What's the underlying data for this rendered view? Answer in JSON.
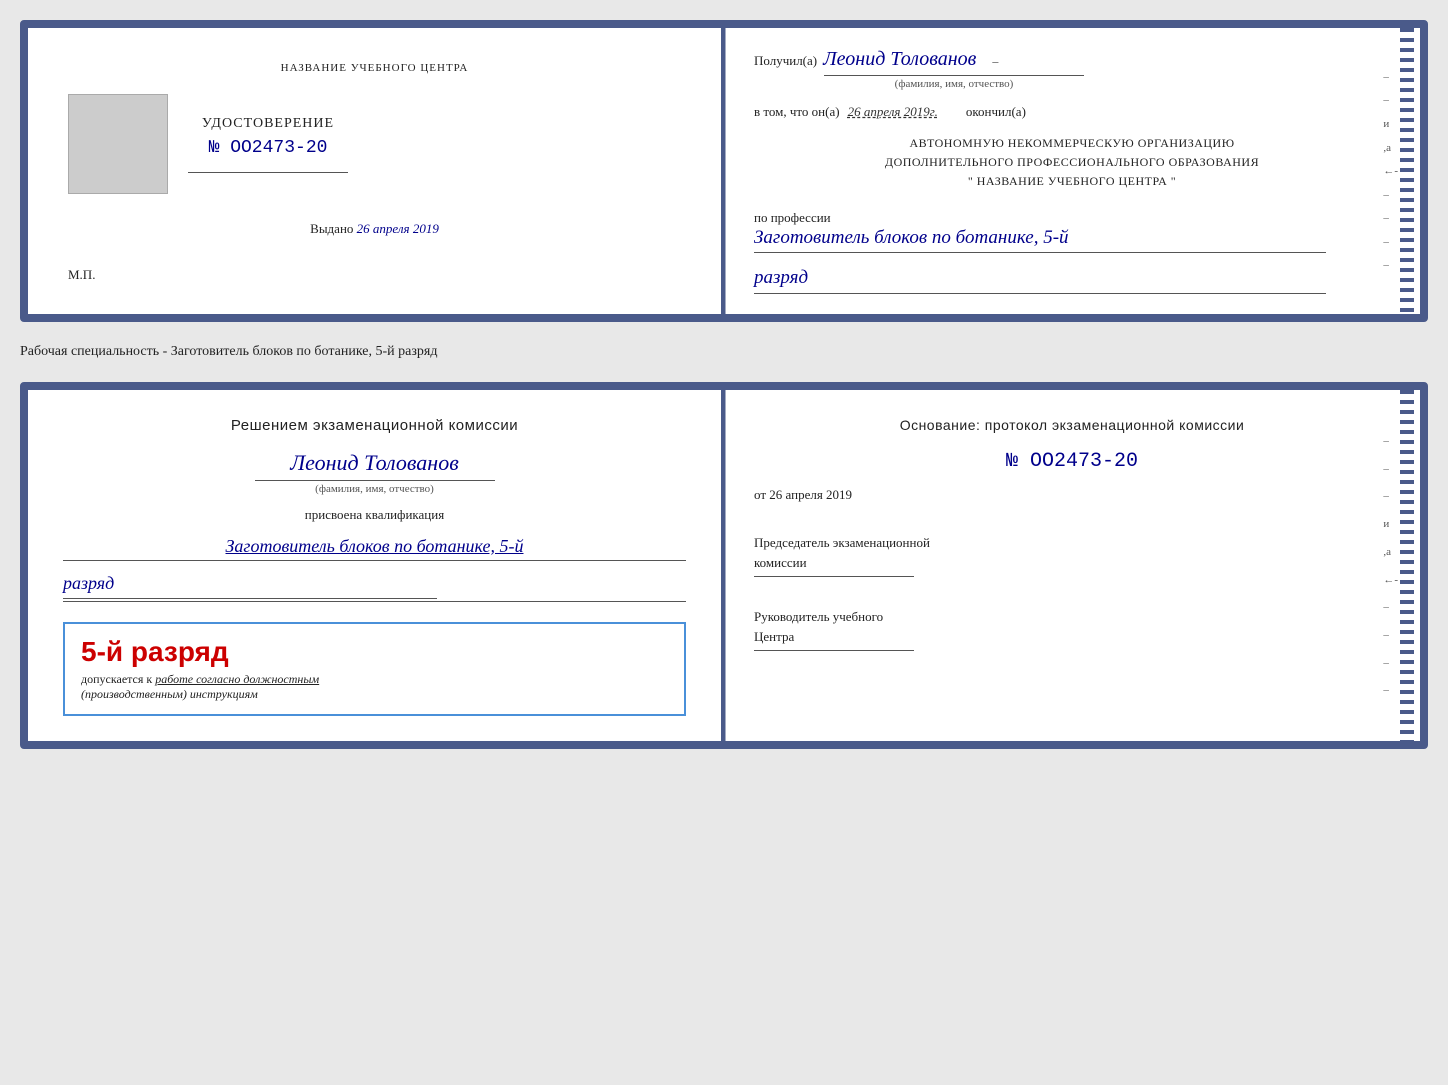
{
  "top_card": {
    "left": {
      "label": "НАЗВАНИЕ УЧЕБНОГО ЦЕНТРА",
      "cert_title": "УДОСТОВЕРЕНИЕ",
      "cert_number_prefix": "№",
      "cert_number": "OO2473-20",
      "issued_label": "Выдано",
      "issued_date": "26 апреля 2019",
      "mp": "М.П."
    },
    "right": {
      "received_label": "Получил(а)",
      "recipient_name": "Леонид Толованов",
      "fio_label": "(фамилия, имя, отчество)",
      "in_that": "в том, что он(а)",
      "date_value": "26 апреля 2019г.",
      "finished": "окончил(а)",
      "org_block_line1": "АВТОНОМНУЮ НЕКОММЕРЧЕСКУЮ ОРГАНИЗАЦИЮ",
      "org_block_line2": "ДОПОЛНИТЕЛЬНОГО ПРОФЕССИОНАЛЬНОГО ОБРАЗОВАНИЯ",
      "org_block_line3": "\"  НАЗВАНИЕ УЧЕБНОГО ЦЕНТРА  \"",
      "profession_label": "по профессии",
      "profession_name": "Заготовитель блоков по ботанике, 5-й",
      "rank": "разряд"
    }
  },
  "specialty_line": "Рабочая специальность - Заготовитель блоков по ботанике, 5-й разряд",
  "bottom_card": {
    "left": {
      "commission_line": "Решением экзаменационной комиссии",
      "person_name": "Леонид Толованов",
      "fio_label": "(фамилия, имя, отчество)",
      "assigned_label": "присвоена квалификация",
      "qual_profession": "Заготовитель блоков по ботанике, 5-й",
      "qual_rank": "разряд",
      "stamp_rank": "5-й разряд",
      "allowed_text": "допускается к",
      "allowed_work": "работе согласно должностным",
      "instructions": "(производственным) инструкциям"
    },
    "right": {
      "osnov_label": "Основание: протокол экзаменационной комиссии",
      "protocol_number": "№  OO2473-20",
      "from_label": "от",
      "from_date": "26 апреля 2019",
      "chairman_title": "Председатель экзаменационной",
      "chairman_title2": "комиссии",
      "director_title": "Руководитель учебного",
      "director_title2": "Центра"
    }
  }
}
